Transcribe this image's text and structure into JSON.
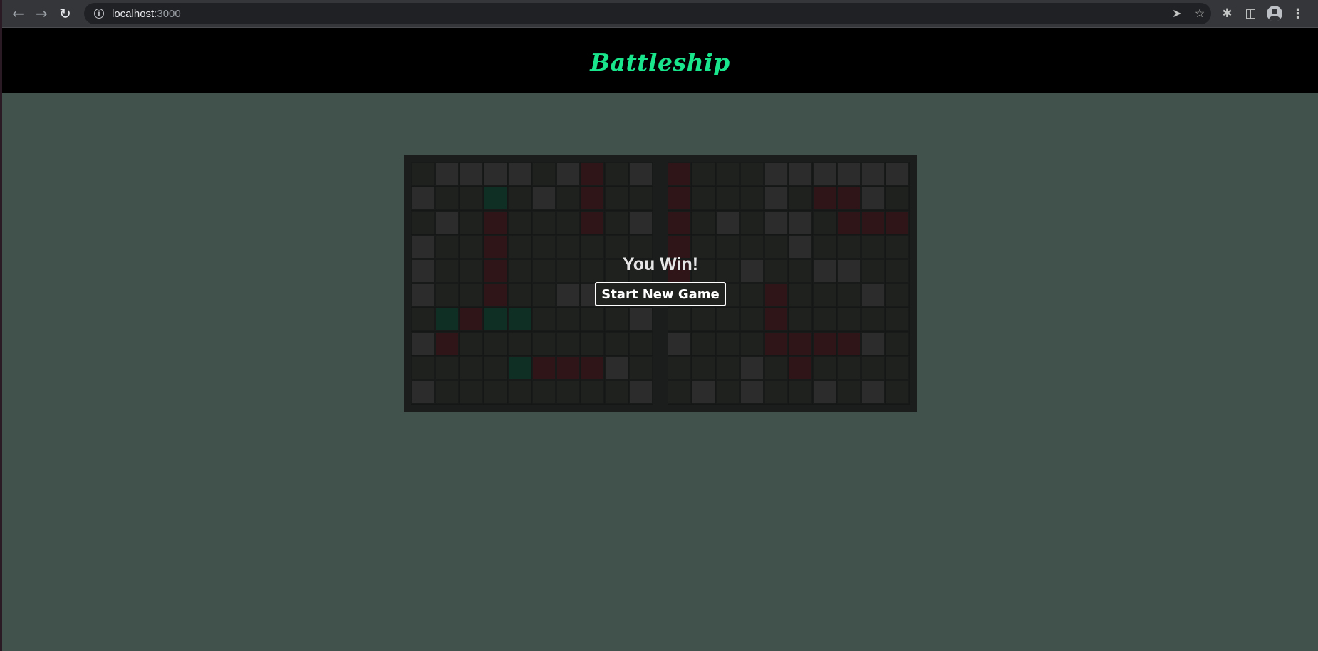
{
  "browser": {
    "back_icon": "←",
    "forward_icon": "→",
    "reload_icon": "↻",
    "url_host": "localhost",
    "url_port": ":3000",
    "info_icon": "i",
    "send_icon": "➤",
    "star_icon": "☆",
    "extensions_icon": "✱",
    "sidepanel_icon": "◫",
    "menu_icon": "⋮"
  },
  "header": {
    "title": "Battleship",
    "title_color": "#19e68c"
  },
  "game": {
    "result_text": "You Win!",
    "new_game_label": "Start New Game",
    "cell_legend": {
      "d": "dark water",
      "l": "light water",
      "h": "hit",
      "m": "miss"
    },
    "boards": [
      {
        "name": "player-board",
        "rows": [
          "dlllldlhdl",
          "lddmdldhdd",
          "dldhdddhdl",
          "lddhdddddd",
          "lddhdddddd",
          "lddhddllld",
          "dmhmmddddl",
          "lhdddddddd",
          "ddddmhhhld",
          "lddddddddl"
        ]
      },
      {
        "name": "enemy-board",
        "rows": [
          "hdddllllll",
          "hdddldhhld",
          "hdldlldhhh",
          "hddddldddd",
          "hddlddlldd",
          "ldddhdddld",
          "ddddhddddd",
          "ldddhhhhld",
          "dddldhdddd",
          "dldlddldld"
        ]
      }
    ]
  }
}
